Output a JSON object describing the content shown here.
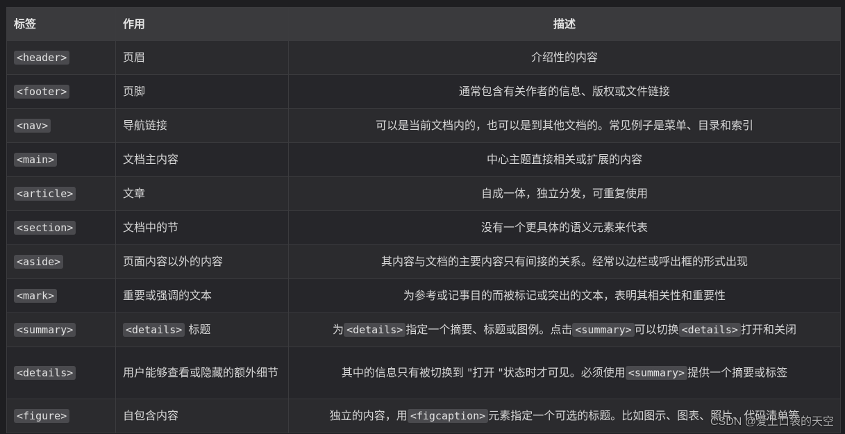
{
  "table": {
    "headers": [
      "标签",
      "作用",
      "描述"
    ],
    "rows": [
      {
        "tag": "<header>",
        "role": "页眉",
        "desc": [
          "介绍性的内容"
        ]
      },
      {
        "tag": "<footer>",
        "role": "页脚",
        "desc": [
          "通常包含有关作者的信息、版权或文件链接"
        ]
      },
      {
        "tag": "<nav>",
        "role": "导航链接",
        "desc": [
          "可以是当前文档内的，也可以是到其他文档的。常见例子是菜单、目录和索引"
        ]
      },
      {
        "tag": "<main>",
        "role": "文档主内容",
        "desc": [
          "中心主题直接相关或扩展的内容"
        ]
      },
      {
        "tag": "<article>",
        "role": "文章",
        "desc": [
          "自成一体，独立分发，可重复使用"
        ]
      },
      {
        "tag": "<section>",
        "role": "文档中的节",
        "desc": [
          "没有一个更具体的语义元素来代表"
        ]
      },
      {
        "tag": "<aside>",
        "role": "页面内容以外的内容",
        "desc": [
          "其内容与文档的主要内容只有间接的关系。经常以边栏或呼出框的形式出现"
        ]
      },
      {
        "tag": "<mark>",
        "role": "重要或强调的文本",
        "desc": [
          "为参考或记事目的而被标记或突出的文本，表明其相关性和重要性"
        ]
      },
      {
        "tag": "<summary>",
        "role_code": "<details>",
        "role": " 标题",
        "desc": [
          "为",
          "<details>",
          "指定一个摘要、标题或图例。点击",
          "<summary>",
          "可以切换",
          "<details>",
          "打开和关闭"
        ]
      },
      {
        "tag": "<details>",
        "role": "用户能够查看或隐藏的额外细节",
        "desc": [
          "其中的信息只有被切换到 \"打开 \"状态时才可见。必须使用",
          "<summary>",
          "提供一个摘要或标签"
        ]
      },
      {
        "tag": "<figure>",
        "role": "自包含内容",
        "desc": [
          "独立的内容，用",
          "<figcaption>",
          "元素指定一个可选的标题。比如图示、图表、照片、代码清单等"
        ]
      }
    ]
  },
  "watermark": "CSDN @爱上口袋的天空"
}
